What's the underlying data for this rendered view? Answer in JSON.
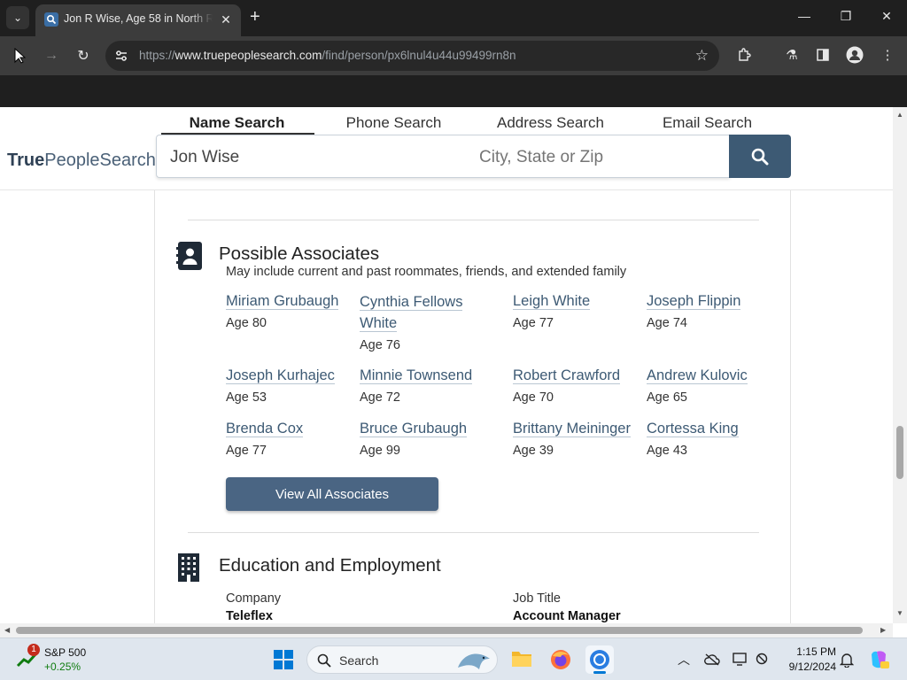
{
  "browser": {
    "tab_title": "Jon R Wise, Age 58 in North R",
    "url_prefix": "https://",
    "url_host": "www.truepeoplesearch.com",
    "url_path": "/find/person/px6lnul4u44u99499rn8n"
  },
  "site": {
    "logo_bold": "True",
    "logo_rest": "PeopleSearch",
    "search_tabs": [
      "Name Search",
      "Phone Search",
      "Address Search",
      "Email Search"
    ],
    "name_value": "Jon Wise",
    "location_placeholder": "City, State or Zip"
  },
  "associates": {
    "title": "Possible Associates",
    "subtitle": "May include current and past roommates, friends, and extended family",
    "people": [
      {
        "name": "Miriam Grubaugh",
        "age": "Age 80"
      },
      {
        "name": "Cynthia Fellows White",
        "age": "Age 76"
      },
      {
        "name": "Leigh White",
        "age": "Age 77"
      },
      {
        "name": "Joseph Flippin",
        "age": "Age 74"
      },
      {
        "name": "Joseph Kurhajec",
        "age": "Age 53"
      },
      {
        "name": "Minnie Townsend",
        "age": "Age 72"
      },
      {
        "name": "Robert Crawford",
        "age": "Age 70"
      },
      {
        "name": "Andrew Kulovic",
        "age": "Age 65"
      },
      {
        "name": "Brenda Cox",
        "age": "Age 77"
      },
      {
        "name": "Bruce Grubaugh",
        "age": "Age 99"
      },
      {
        "name": "Brittany Meininger",
        "age": "Age 39"
      },
      {
        "name": "Cortessa King",
        "age": "Age 43"
      }
    ],
    "view_all_label": "View All Associates"
  },
  "education": {
    "title": "Education and Employment",
    "company_label": "Company",
    "company_value": "Teleflex",
    "job_label": "Job Title",
    "job_value": "Account Manager"
  },
  "taskbar": {
    "stock_name": "S&P 500",
    "stock_change": "+0.25%",
    "notification_count": "1",
    "search_label": "Search",
    "time": "1:15 PM",
    "date": "9/12/2024"
  }
}
